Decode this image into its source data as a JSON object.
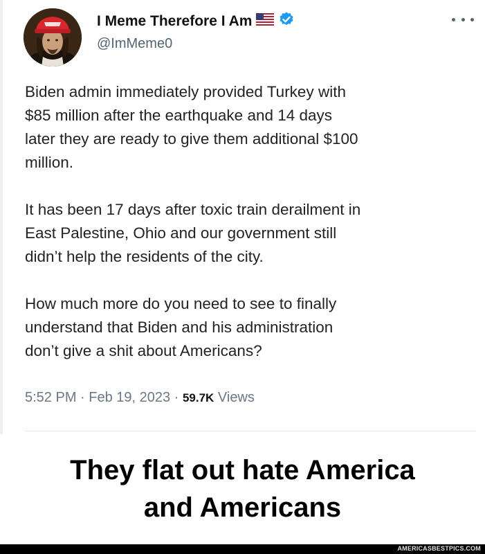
{
  "tweet": {
    "author": {
      "name": "I Meme Therefore I Am",
      "handle": "@ImMeme0",
      "avatar": "avatar-descartes-in-red-cap",
      "flag_icon": "us-flag-icon",
      "verified_icon": "verified-badge-icon",
      "verified_color": "#1d9bf0"
    },
    "more_icon": "more-options-icon",
    "paragraphs": [
      "Biden admin immediately provided Turkey with\n$85 million after the earthquake and 14 days\nlater they are ready to give them additional $100\nmillion.",
      "It has been 17 days after toxic train derailment in\nEast Palestine, Ohio and our government still\ndidn’t help the residents of the city.",
      "How much more do you need to see to finally\nunderstand that Biden and his administration\ndon’t give a shit about Americans?"
    ],
    "time": "5:52 PM",
    "date": "Feb 19, 2023",
    "separator": "·",
    "views_count": "59.7K",
    "views_label": "Views"
  },
  "caption": {
    "line1": "They flat out hate America",
    "line2": "and Americans"
  },
  "watermark": "AMERICASBESTPICS.COM"
}
